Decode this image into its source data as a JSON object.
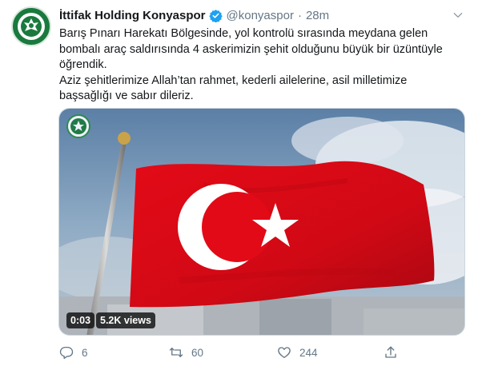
{
  "tweet": {
    "author_name": "İttifak Holding Konyaspor",
    "handle": "@konyaspor",
    "separator": "·",
    "time": "28m",
    "text_line_1": "Barış Pınarı Harekatı Bölgesinde, yol kontrolü sırasında meydana gelen",
    "text_line_2": "bombalı araç saldırısında 4 askerimizin şehit olduğunu büyük bir üzüntüyle",
    "text_line_3": "öğrendik.",
    "text_line_4": "Aziz şehitlerimize Allah’tan rahmet, kederli ailelerine, asil milletimize",
    "text_line_5": "başsağlığı ve sabır dileriz."
  },
  "media": {
    "duration": "0:03",
    "views": "5.2K views",
    "flag_color": "#e30a17"
  },
  "actions": {
    "reply_count": "6",
    "retweet_count": "60",
    "like_count": "244"
  },
  "icons": {
    "verified": "verified-badge-icon",
    "caret": "chevron-down-icon",
    "reply": "reply-icon",
    "retweet": "retweet-icon",
    "like": "heart-icon",
    "share": "share-icon"
  }
}
